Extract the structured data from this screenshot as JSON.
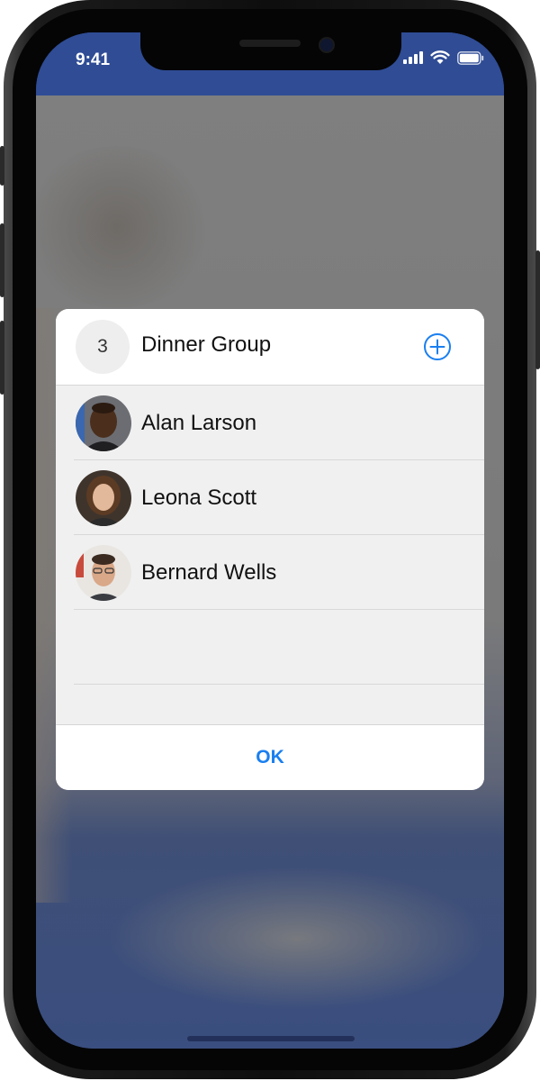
{
  "status_bar": {
    "time": "9:41"
  },
  "dialog": {
    "count": "3",
    "title": "Dinner Group",
    "members": [
      {
        "name": "Alan Larson"
      },
      {
        "name": "Leona Scott"
      },
      {
        "name": "Bernard Wells"
      }
    ],
    "ok_label": "OK"
  },
  "colors": {
    "accent": "#1a7ff0",
    "screen_bg": "#334f94",
    "card": "#ffffff"
  },
  "icons": {
    "add": "plus-circle-icon",
    "signal": "cellular-signal-icon",
    "wifi": "wifi-icon",
    "battery": "battery-icon"
  }
}
